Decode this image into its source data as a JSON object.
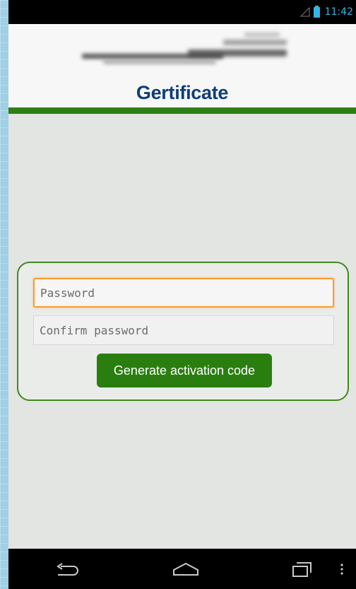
{
  "status_bar": {
    "time": "11:42",
    "icons": [
      "signal-icon",
      "battery-icon"
    ]
  },
  "header": {
    "title": "Gertificate",
    "logo": "blurred-logo"
  },
  "form": {
    "password_placeholder": "Password",
    "password_value": "",
    "confirm_placeholder": "Confirm password",
    "confirm_value": "",
    "submit_label": "Generate activation code"
  },
  "nav_bar": {
    "icons": [
      "back-icon",
      "home-icon",
      "recent-apps-icon",
      "overflow-menu-icon"
    ]
  },
  "colors": {
    "brand_green": "#2a7e10",
    "title_blue": "#0f3d7a",
    "focus_orange": "#ff9a2e",
    "status_blue": "#33b5e5"
  }
}
